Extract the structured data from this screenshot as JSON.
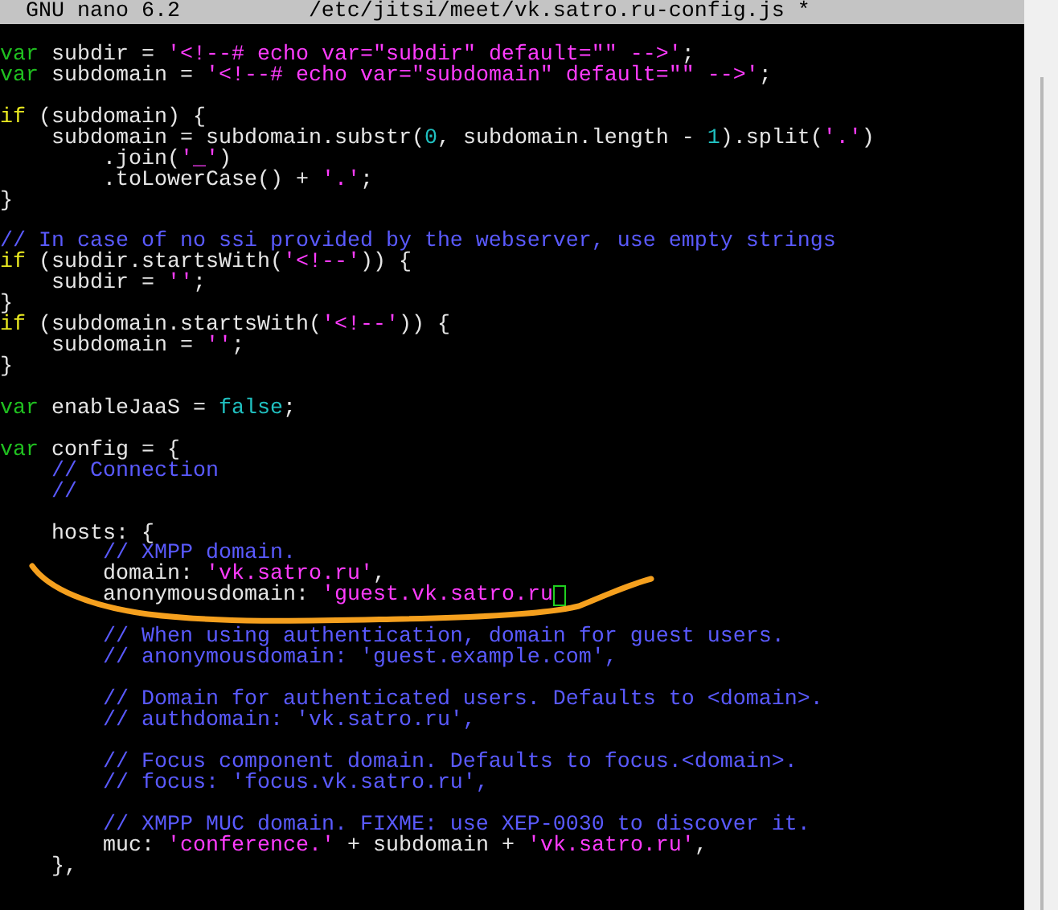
{
  "title_bar": {
    "app": "GNU nano 6.2",
    "file": "/etc/jitsi/meet/vk.satro.ru-config.js",
    "modified": "*"
  },
  "lines": [
    {
      "gap_before": true,
      "segments": [
        {
          "kind": "keyword",
          "text": "var"
        },
        {
          "kind": "plain",
          "text": " subdir = "
        },
        {
          "kind": "string",
          "text": "'<!--# echo var=\"subdir\" default=\"\" -->'"
        },
        {
          "kind": "plain",
          "text": ";"
        }
      ]
    },
    {
      "segments": [
        {
          "kind": "keyword",
          "text": "var"
        },
        {
          "kind": "plain",
          "text": " subdomain = "
        },
        {
          "kind": "string",
          "text": "'<!--# echo var=\"subdomain\" default=\"\" -->'"
        },
        {
          "kind": "plain",
          "text": ";"
        }
      ]
    },
    {
      "gap_before": true,
      "segments": [
        {
          "kind": "control",
          "text": "if"
        },
        {
          "kind": "plain",
          "text": " (subdomain) {"
        }
      ]
    },
    {
      "segments": [
        {
          "kind": "plain",
          "text": "    subdomain = subdomain.substr("
        },
        {
          "kind": "number",
          "text": "0"
        },
        {
          "kind": "plain",
          "text": ", subdomain.length - "
        },
        {
          "kind": "number",
          "text": "1"
        },
        {
          "kind": "plain",
          "text": ").split("
        },
        {
          "kind": "string",
          "text": "'.'"
        },
        {
          "kind": "plain",
          "text": ")"
        }
      ]
    },
    {
      "segments": [
        {
          "kind": "plain",
          "text": "        .join("
        },
        {
          "kind": "string",
          "text": "'_'"
        },
        {
          "kind": "plain",
          "text": ")"
        }
      ]
    },
    {
      "segments": [
        {
          "kind": "plain",
          "text": "        .toLowerCase() + "
        },
        {
          "kind": "string",
          "text": "'.'"
        },
        {
          "kind": "plain",
          "text": ";"
        }
      ]
    },
    {
      "segments": [
        {
          "kind": "plain",
          "text": "}"
        }
      ]
    },
    {
      "gap_before": true,
      "segments": [
        {
          "kind": "comment",
          "text": "// In case of no ssi provided by the webserver, use empty strings"
        }
      ]
    },
    {
      "segments": [
        {
          "kind": "control",
          "text": "if"
        },
        {
          "kind": "plain",
          "text": " (subdir.startsWith("
        },
        {
          "kind": "string",
          "text": "'<!--'"
        },
        {
          "kind": "plain",
          "text": ")) {"
        }
      ]
    },
    {
      "segments": [
        {
          "kind": "plain",
          "text": "    subdir = "
        },
        {
          "kind": "string",
          "text": "''"
        },
        {
          "kind": "plain",
          "text": ";"
        }
      ]
    },
    {
      "segments": [
        {
          "kind": "plain",
          "text": "}"
        }
      ]
    },
    {
      "segments": [
        {
          "kind": "control",
          "text": "if"
        },
        {
          "kind": "plain",
          "text": " (subdomain.startsWith("
        },
        {
          "kind": "string",
          "text": "'<!--'"
        },
        {
          "kind": "plain",
          "text": ")) {"
        }
      ]
    },
    {
      "segments": [
        {
          "kind": "plain",
          "text": "    subdomain = "
        },
        {
          "kind": "string",
          "text": "''"
        },
        {
          "kind": "plain",
          "text": ";"
        }
      ]
    },
    {
      "segments": [
        {
          "kind": "plain",
          "text": "}"
        }
      ]
    },
    {
      "gap_before": true,
      "segments": [
        {
          "kind": "keyword",
          "text": "var"
        },
        {
          "kind": "plain",
          "text": " enableJaaS = "
        },
        {
          "kind": "number",
          "text": "false"
        },
        {
          "kind": "plain",
          "text": ";"
        }
      ]
    },
    {
      "gap_before": true,
      "segments": [
        {
          "kind": "keyword",
          "text": "var"
        },
        {
          "kind": "plain",
          "text": " config = {"
        }
      ]
    },
    {
      "segments": [
        {
          "kind": "comment",
          "text": "    // Connection"
        }
      ]
    },
    {
      "segments": [
        {
          "kind": "comment",
          "text": "    //"
        }
      ]
    },
    {
      "gap_before": true,
      "segments": [
        {
          "kind": "plain",
          "text": "    hosts: {"
        }
      ]
    },
    {
      "segments": [
        {
          "kind": "comment",
          "text": "        // XMPP domain."
        }
      ]
    },
    {
      "segments": [
        {
          "kind": "plain",
          "text": "        domain: "
        },
        {
          "kind": "string",
          "text": "'vk.satro.ru'"
        },
        {
          "kind": "plain",
          "text": ","
        }
      ]
    },
    {
      "segments": [
        {
          "kind": "plain",
          "text": "        anonymousdomain: "
        },
        {
          "kind": "string",
          "text": "'guest.vk.satro.ru"
        }
      ],
      "cursor": true
    },
    {
      "gap_before": true,
      "segments": [
        {
          "kind": "comment",
          "text": "        // When using authentication, domain for guest users."
        }
      ]
    },
    {
      "segments": [
        {
          "kind": "comment",
          "text": "        // anonymousdomain: 'guest.example.com',"
        }
      ]
    },
    {
      "gap_before": true,
      "segments": [
        {
          "kind": "comment",
          "text": "        // Domain for authenticated users. Defaults to <domain>."
        }
      ]
    },
    {
      "segments": [
        {
          "kind": "comment",
          "text": "        // authdomain: 'vk.satro.ru',"
        }
      ]
    },
    {
      "gap_before": true,
      "segments": [
        {
          "kind": "comment",
          "text": "        // Focus component domain. Defaults to focus.<domain>."
        }
      ]
    },
    {
      "segments": [
        {
          "kind": "comment",
          "text": "        // focus: 'focus.vk.satro.ru',"
        }
      ]
    },
    {
      "gap_before": true,
      "segments": [
        {
          "kind": "comment",
          "text": "        // XMPP MUC domain. FIXME: use XEP-0030 to discover it."
        }
      ]
    },
    {
      "segments": [
        {
          "kind": "plain",
          "text": "        muc: "
        },
        {
          "kind": "string",
          "text": "'conference.'"
        },
        {
          "kind": "plain",
          "text": " + subdomain + "
        },
        {
          "kind": "string",
          "text": "'vk.satro.ru'"
        },
        {
          "kind": "plain",
          "text": ","
        }
      ]
    },
    {
      "segments": [
        {
          "kind": "plain",
          "text": "    },"
        }
      ]
    }
  ]
}
